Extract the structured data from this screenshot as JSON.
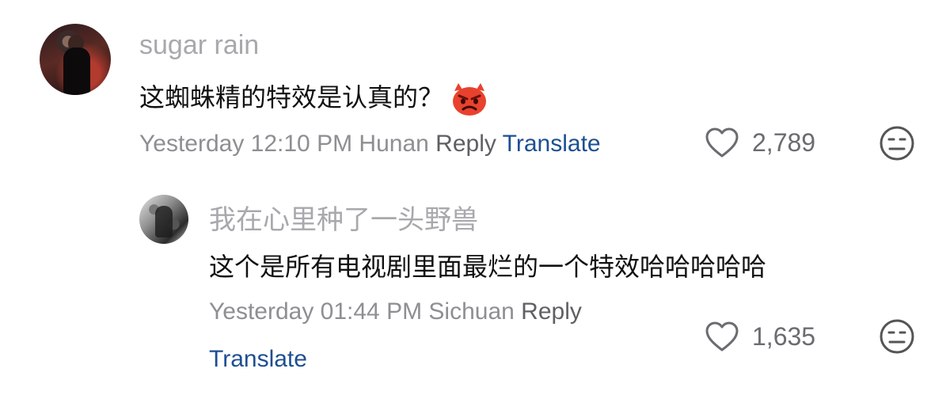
{
  "comments": [
    {
      "username": "sugar rain",
      "text": "这蜘蛛精的特效是认真的？",
      "emoji": "angry-face-with-horns",
      "time": "Yesterday 12:10 PM",
      "location": "Hunan",
      "reply_label": "Reply",
      "translate_label": "Translate",
      "likes": "2,789"
    },
    {
      "username": "我在心里种了一头野兽",
      "text": "这个是所有电视剧里面最烂的一个特效哈哈哈哈哈",
      "time": "Yesterday 01:44 PM",
      "location": "Sichuan",
      "reply_label": "Reply",
      "translate_label": "Translate",
      "likes": "1,635"
    }
  ],
  "colors": {
    "username": "#a8a8ad",
    "meta": "#8e8e93",
    "translate": "#1d4f91",
    "emoji": "#e8422e"
  },
  "icons": {
    "like": "heart-outline-icon",
    "reaction": "neutral-face-icon"
  }
}
